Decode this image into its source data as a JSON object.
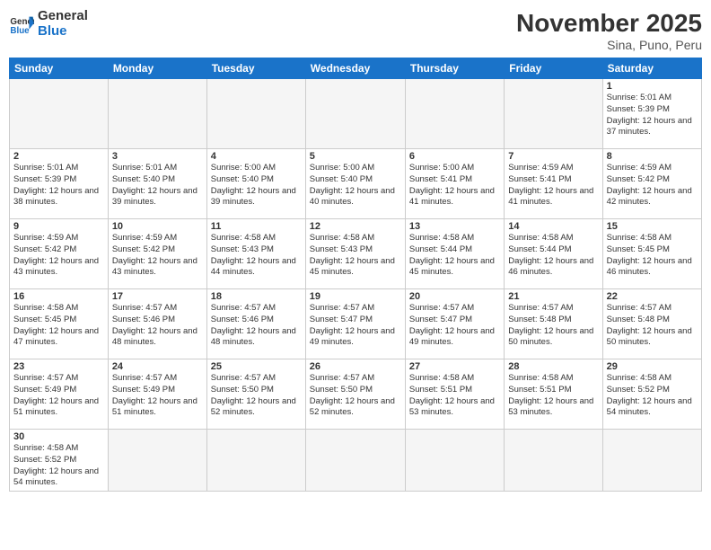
{
  "header": {
    "logo_general": "General",
    "logo_blue": "Blue",
    "month_title": "November 2025",
    "subtitle": "Sina, Puno, Peru"
  },
  "days_of_week": [
    "Sunday",
    "Monday",
    "Tuesday",
    "Wednesday",
    "Thursday",
    "Friday",
    "Saturday"
  ],
  "weeks": [
    [
      {
        "day": "",
        "info": ""
      },
      {
        "day": "",
        "info": ""
      },
      {
        "day": "",
        "info": ""
      },
      {
        "day": "",
        "info": ""
      },
      {
        "day": "",
        "info": ""
      },
      {
        "day": "",
        "info": ""
      },
      {
        "day": "1",
        "info": "Sunrise: 5:01 AM\nSunset: 5:39 PM\nDaylight: 12 hours\nand 37 minutes."
      }
    ],
    [
      {
        "day": "2",
        "info": "Sunrise: 5:01 AM\nSunset: 5:39 PM\nDaylight: 12 hours\nand 38 minutes."
      },
      {
        "day": "3",
        "info": "Sunrise: 5:01 AM\nSunset: 5:40 PM\nDaylight: 12 hours\nand 39 minutes."
      },
      {
        "day": "4",
        "info": "Sunrise: 5:00 AM\nSunset: 5:40 PM\nDaylight: 12 hours\nand 39 minutes."
      },
      {
        "day": "5",
        "info": "Sunrise: 5:00 AM\nSunset: 5:40 PM\nDaylight: 12 hours\nand 40 minutes."
      },
      {
        "day": "6",
        "info": "Sunrise: 5:00 AM\nSunset: 5:41 PM\nDaylight: 12 hours\nand 41 minutes."
      },
      {
        "day": "7",
        "info": "Sunrise: 4:59 AM\nSunset: 5:41 PM\nDaylight: 12 hours\nand 41 minutes."
      },
      {
        "day": "8",
        "info": "Sunrise: 4:59 AM\nSunset: 5:42 PM\nDaylight: 12 hours\nand 42 minutes."
      }
    ],
    [
      {
        "day": "9",
        "info": "Sunrise: 4:59 AM\nSunset: 5:42 PM\nDaylight: 12 hours\nand 43 minutes."
      },
      {
        "day": "10",
        "info": "Sunrise: 4:59 AM\nSunset: 5:42 PM\nDaylight: 12 hours\nand 43 minutes."
      },
      {
        "day": "11",
        "info": "Sunrise: 4:58 AM\nSunset: 5:43 PM\nDaylight: 12 hours\nand 44 minutes."
      },
      {
        "day": "12",
        "info": "Sunrise: 4:58 AM\nSunset: 5:43 PM\nDaylight: 12 hours\nand 45 minutes."
      },
      {
        "day": "13",
        "info": "Sunrise: 4:58 AM\nSunset: 5:44 PM\nDaylight: 12 hours\nand 45 minutes."
      },
      {
        "day": "14",
        "info": "Sunrise: 4:58 AM\nSunset: 5:44 PM\nDaylight: 12 hours\nand 46 minutes."
      },
      {
        "day": "15",
        "info": "Sunrise: 4:58 AM\nSunset: 5:45 PM\nDaylight: 12 hours\nand 46 minutes."
      }
    ],
    [
      {
        "day": "16",
        "info": "Sunrise: 4:58 AM\nSunset: 5:45 PM\nDaylight: 12 hours\nand 47 minutes."
      },
      {
        "day": "17",
        "info": "Sunrise: 4:57 AM\nSunset: 5:46 PM\nDaylight: 12 hours\nand 48 minutes."
      },
      {
        "day": "18",
        "info": "Sunrise: 4:57 AM\nSunset: 5:46 PM\nDaylight: 12 hours\nand 48 minutes."
      },
      {
        "day": "19",
        "info": "Sunrise: 4:57 AM\nSunset: 5:47 PM\nDaylight: 12 hours\nand 49 minutes."
      },
      {
        "day": "20",
        "info": "Sunrise: 4:57 AM\nSunset: 5:47 PM\nDaylight: 12 hours\nand 49 minutes."
      },
      {
        "day": "21",
        "info": "Sunrise: 4:57 AM\nSunset: 5:48 PM\nDaylight: 12 hours\nand 50 minutes."
      },
      {
        "day": "22",
        "info": "Sunrise: 4:57 AM\nSunset: 5:48 PM\nDaylight: 12 hours\nand 50 minutes."
      }
    ],
    [
      {
        "day": "23",
        "info": "Sunrise: 4:57 AM\nSunset: 5:49 PM\nDaylight: 12 hours\nand 51 minutes."
      },
      {
        "day": "24",
        "info": "Sunrise: 4:57 AM\nSunset: 5:49 PM\nDaylight: 12 hours\nand 51 minutes."
      },
      {
        "day": "25",
        "info": "Sunrise: 4:57 AM\nSunset: 5:50 PM\nDaylight: 12 hours\nand 52 minutes."
      },
      {
        "day": "26",
        "info": "Sunrise: 4:57 AM\nSunset: 5:50 PM\nDaylight: 12 hours\nand 52 minutes."
      },
      {
        "day": "27",
        "info": "Sunrise: 4:58 AM\nSunset: 5:51 PM\nDaylight: 12 hours\nand 53 minutes."
      },
      {
        "day": "28",
        "info": "Sunrise: 4:58 AM\nSunset: 5:51 PM\nDaylight: 12 hours\nand 53 minutes."
      },
      {
        "day": "29",
        "info": "Sunrise: 4:58 AM\nSunset: 5:52 PM\nDaylight: 12 hours\nand 54 minutes."
      }
    ],
    [
      {
        "day": "30",
        "info": "Sunrise: 4:58 AM\nSunset: 5:52 PM\nDaylight: 12 hours\nand 54 minutes."
      },
      {
        "day": "",
        "info": ""
      },
      {
        "day": "",
        "info": ""
      },
      {
        "day": "",
        "info": ""
      },
      {
        "day": "",
        "info": ""
      },
      {
        "day": "",
        "info": ""
      },
      {
        "day": "",
        "info": ""
      }
    ]
  ]
}
